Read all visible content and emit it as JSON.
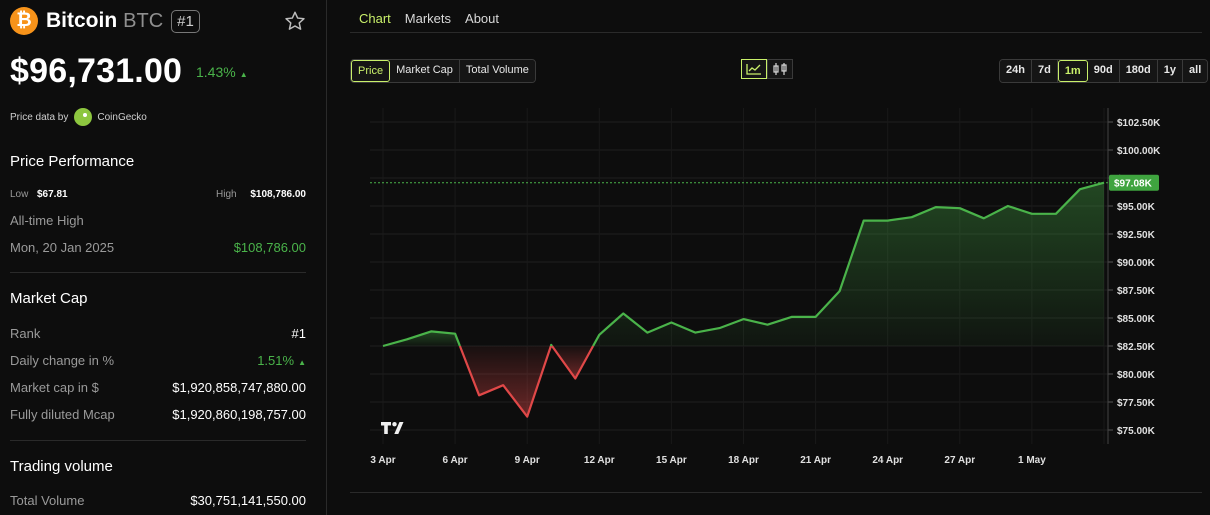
{
  "coin": {
    "logo_glyph": "₿",
    "name": "Bitcoin",
    "symbol": "BTC",
    "rank_badge": "#1",
    "price": "$96,731.00",
    "change": "1.43%",
    "change_arrow": "▲",
    "price_data_by": "Price data by",
    "provider": "CoinGecko"
  },
  "performance": {
    "title": "Price Performance",
    "low_label": "Low",
    "low_value": "$67.81",
    "high_label": "High",
    "high_value": "$108,786.00",
    "ath_label": "All-time High",
    "ath_date": "Mon, 20 Jan 2025",
    "ath_value": "$108,786.00"
  },
  "market_cap": {
    "title": "Market Cap",
    "rank_label": "Rank",
    "rank_value": "#1",
    "daily_label": "Daily change in %",
    "daily_value": "1.51%",
    "daily_arrow": "▲",
    "mcap_label": "Market cap in $",
    "mcap_value": "$1,920,858,747,880.00",
    "fdv_label": "Fully diluted Mcap",
    "fdv_value": "$1,920,860,198,757.00"
  },
  "trading": {
    "title": "Trading volume",
    "total_label": "Total Volume",
    "total_value": "$30,751,141,550.00"
  },
  "tabs": [
    "Chart",
    "Markets",
    "About"
  ],
  "metric_buttons": [
    "Price",
    "Market Cap",
    "Total Volume"
  ],
  "range_buttons": [
    "24h",
    "7d",
    "1m",
    "90d",
    "180d",
    "1y",
    "all"
  ],
  "colors": {
    "up": "#4ab34a",
    "down": "#e04848",
    "accent": "#c9f06a",
    "current": "#3fa43f"
  },
  "chart_data": {
    "type": "line",
    "title": "",
    "xlabel": "",
    "ylabel": "",
    "x_ticks": [
      "3 Apr",
      "6 Apr",
      "9 Apr",
      "12 Apr",
      "15 Apr",
      "18 Apr",
      "21 Apr",
      "24 Apr",
      "27 Apr",
      "1 May"
    ],
    "y_ticks": [
      "$102.50K",
      "$100.00K",
      "$97.50K",
      "$95.00K",
      "$92.50K",
      "$90.00K",
      "$87.50K",
      "$85.00K",
      "$82.50K",
      "$80.00K",
      "$77.50K",
      "$75.00K"
    ],
    "ylim": [
      73750,
      103750
    ],
    "baseline": 82500,
    "current_label": "$97.08K",
    "current_value": 97080,
    "series": [
      {
        "values": [
          82500,
          83100,
          83800,
          83600,
          78100,
          79000,
          76200,
          82600,
          79600,
          83500,
          85400,
          83700,
          84600,
          83700,
          84100,
          84900,
          84400,
          85100,
          85100,
          87400,
          93700,
          93700,
          94000,
          94900,
          94800,
          93900,
          95000,
          94300,
          94300,
          96500,
          97080
        ]
      }
    ]
  }
}
